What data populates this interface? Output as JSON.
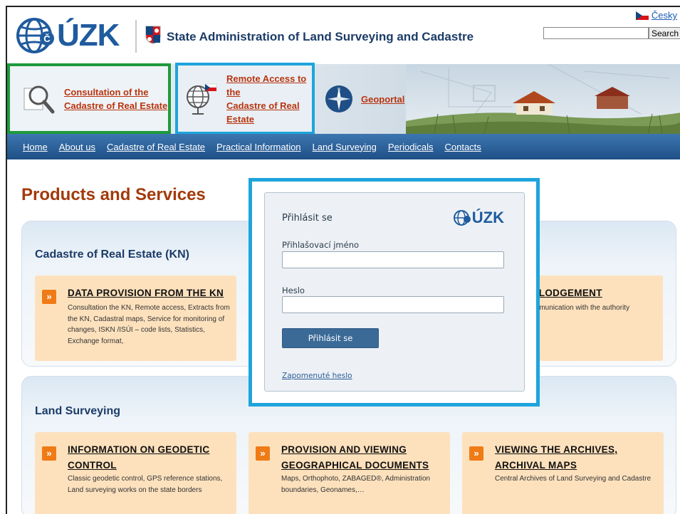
{
  "header": {
    "logo_text": "ÚZK",
    "site_title": "State Administration of Land Surveying and Cadastre",
    "language_link": "Česky",
    "search": {
      "value": "",
      "button_label": "Search"
    }
  },
  "quick_links": [
    {
      "line1": "Consultation of the",
      "line2": "Cadastre of Real Estate"
    },
    {
      "line1": "Remote Access to the",
      "line2": "Cadastre of Real Estate"
    },
    {
      "line1": "Geoportal",
      "line2": ""
    }
  ],
  "nav": {
    "items": [
      "Home",
      "About us",
      "Cadastre of Real Estate",
      "Practical Information",
      "Land Surveying",
      "Periodicals",
      "Contacts"
    ]
  },
  "page": {
    "title": "Products and Services"
  },
  "sections": [
    {
      "title": "Cadastre of Real Estate (KN)",
      "cards": [
        {
          "title": "DATA PROVISION FROM THE KN",
          "description": "Consultation the KN, Remote access, Extracts from the KN, Cadastral maps, Service for monitoring of changes, ISKN /ISÚI – code lists, Statistics, Exchange format,"
        },
        {
          "title": "eLODGEMENT",
          "description": "mmunication with the authority"
        }
      ]
    },
    {
      "title": "Land Surveying",
      "cards": [
        {
          "title": "INFORMATION ON GEODETIC CONTROL",
          "description": "Classic geodetic control, GPS reference stations, Land surveying works on the state borders"
        },
        {
          "title": "PROVISION AND VIEWING GEOGRAPHICAL DOCUMENTS",
          "description": "Maps, Orthophoto, ZABAGED®, Administration boundaries, Geonames,…"
        },
        {
          "title": "VIEWING THE ARCHIVES, ARCHIVAL MAPS",
          "description": "Central Archives of Land Surveying and Cadastre"
        }
      ]
    }
  ],
  "login": {
    "title": "Přihlásit se",
    "logo_text": "ÚZK",
    "username_label": "Přihlašovací jméno",
    "username_value": "",
    "password_label": "Heslo",
    "password_value": "",
    "submit_label": "Přihlásit se",
    "forgot_link": "Zapomenuté heslo"
  },
  "colors": {
    "brand_blue": "#1f5b9e",
    "accent_orange": "#ef7b17",
    "title_rust": "#a33a0b",
    "highlight_green": "#1e9a3a",
    "highlight_cyan": "#1ea4dc"
  }
}
